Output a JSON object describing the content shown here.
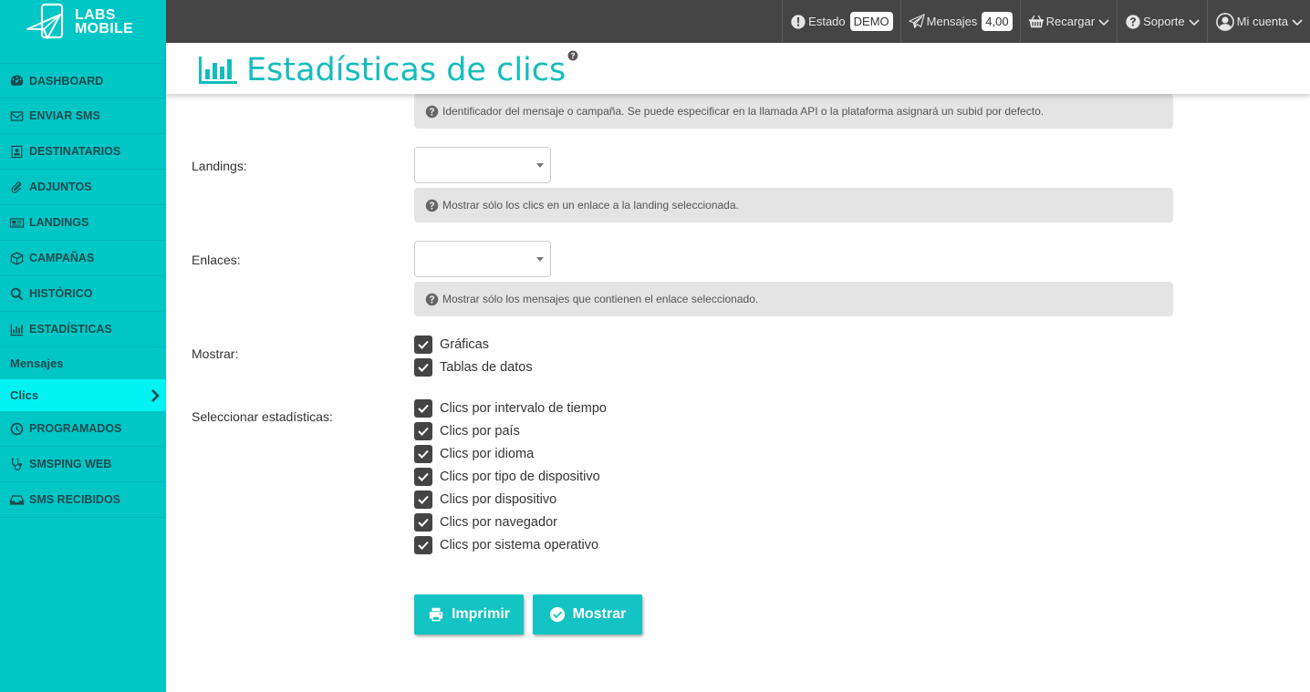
{
  "brand": {
    "line1": "LABS",
    "line2": "MOBILE"
  },
  "sidebar": {
    "items": [
      {
        "label": "DASHBOARD",
        "icon": "dashboard-icon"
      },
      {
        "label": "ENVIAR SMS",
        "icon": "envelope-icon"
      },
      {
        "label": "DESTINATARIOS",
        "icon": "contact-card-icon"
      },
      {
        "label": "ADJUNTOS",
        "icon": "paperclip-icon"
      },
      {
        "label": "LANDINGS",
        "icon": "newspaper-icon"
      },
      {
        "label": "CAMPAÑAS",
        "icon": "cube-icon"
      },
      {
        "label": "HISTÓRICO",
        "icon": "search-icon"
      },
      {
        "label": "ESTADÍSTICAS",
        "icon": "bar-chart-icon"
      }
    ],
    "subitems": [
      {
        "label": "Mensajes"
      },
      {
        "label": "Clics",
        "active": true
      }
    ],
    "items_after": [
      {
        "label": "PROGRAMADOS",
        "icon": "clock-icon"
      },
      {
        "label": "SMSPING WEB",
        "icon": "stethoscope-icon"
      },
      {
        "label": "SMS RECIBIDOS",
        "icon": "inbox-icon"
      }
    ]
  },
  "topbar": {
    "estado_label": "Estado",
    "estado_value": "DEMO",
    "mensajes_label": "Mensajes",
    "mensajes_value": "4,00",
    "recargar_label": "Recargar",
    "soporte_label": "Soporte",
    "cuenta_label": "Mi cuenta"
  },
  "page": {
    "title": "Estadísticas de clics"
  },
  "form": {
    "subid_hint": "Identificador del mensaje o campaña. Se puede especificar en la llamada API o la plataforma asignará un subid por defecto.",
    "landings_label": "Landings:",
    "landings_value": "",
    "landings_hint": "Mostrar sólo los clics en un enlace a la landing seleccionada.",
    "enlaces_label": "Enlaces:",
    "enlaces_value": "",
    "enlaces_hint": "Mostrar sólo los mensajes que contienen el enlace seleccionado.",
    "mostrar_label": "Mostrar:",
    "mostrar_options": [
      {
        "label": "Gráficas",
        "checked": true
      },
      {
        "label": "Tablas de datos",
        "checked": true
      }
    ],
    "stats_label": "Seleccionar estadísticas:",
    "stats_options": [
      {
        "label": "Clics por intervalo de tiempo",
        "checked": true
      },
      {
        "label": "Clics por país",
        "checked": true
      },
      {
        "label": "Clics por idioma",
        "checked": true
      },
      {
        "label": "Clics por tipo de dispositivo",
        "checked": true
      },
      {
        "label": "Clics por dispositivo",
        "checked": true
      },
      {
        "label": "Clics por navegador",
        "checked": true
      },
      {
        "label": "Clics por sistema operativo",
        "checked": true
      }
    ]
  },
  "buttons": {
    "print_label": "Imprimir",
    "show_label": "Mostrar"
  },
  "colors": {
    "accent": "#14c3c3",
    "sidebar": "#00c6c6",
    "sidebar_active": "#00f2f2",
    "topbar": "#454545"
  }
}
